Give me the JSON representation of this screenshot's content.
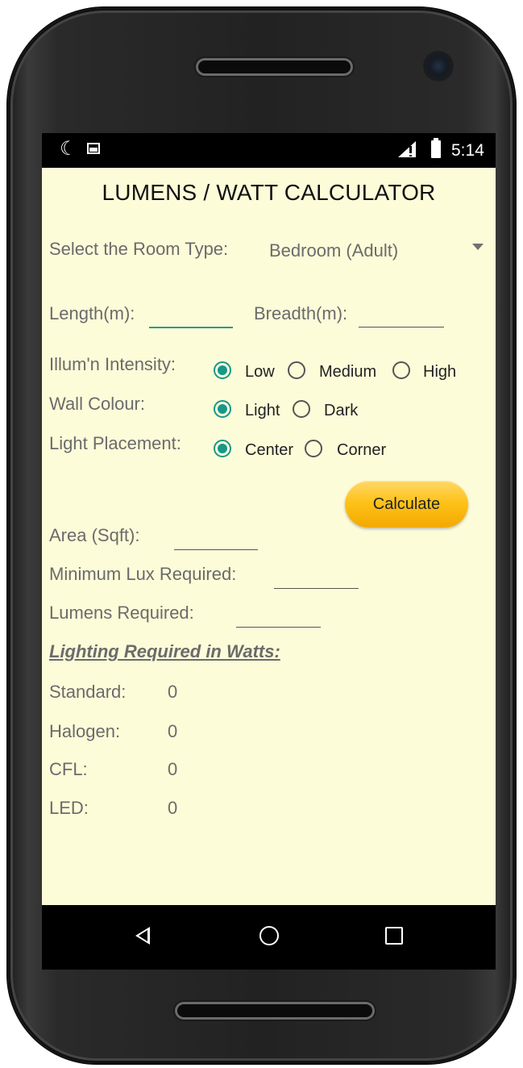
{
  "status_bar": {
    "time": "5:14"
  },
  "app": {
    "title": "LUMENS / WATT CALCULATOR"
  },
  "room": {
    "label": "Select the Room Type:",
    "selected": "Bedroom (Adult)"
  },
  "dimensions": {
    "length_label": "Length(m):",
    "length_value": "",
    "breadth_label": "Breadth(m):",
    "breadth_value": ""
  },
  "illumination": {
    "label": "Illum'n Intensity:",
    "options": [
      "Low",
      "Medium",
      "High"
    ],
    "selected": "Low"
  },
  "wall_colour": {
    "label": "Wall Colour:",
    "options": [
      "Light",
      "Dark"
    ],
    "selected": "Light"
  },
  "placement": {
    "label": "Light Placement:",
    "options": [
      "Center",
      "Corner"
    ],
    "selected": "Center"
  },
  "calculate_label": "Calculate",
  "results": {
    "area_label": "Area (Sqft):",
    "area_value": "",
    "min_lux_label": "Minimum Lux Required:",
    "min_lux_value": "",
    "lumens_label": "Lumens Required:",
    "lumens_value": ""
  },
  "watts": {
    "heading": "Lighting Required in Watts:",
    "rows": [
      {
        "label": "Standard:",
        "value": "0"
      },
      {
        "label": "Halogen:",
        "value": "0"
      },
      {
        "label": "CFL:",
        "value": "0"
      },
      {
        "label": "LED:",
        "value": "0"
      }
    ]
  },
  "colors": {
    "screen_bg": "#fdfcd9",
    "accent": "#17988a",
    "button": "#ffc21a"
  },
  "icons": {
    "status_left": [
      "moon-icon",
      "image-icon"
    ],
    "status_right": [
      "signal-icon",
      "battery-icon"
    ],
    "nav": [
      "back-icon",
      "home-icon",
      "recents-icon"
    ]
  }
}
